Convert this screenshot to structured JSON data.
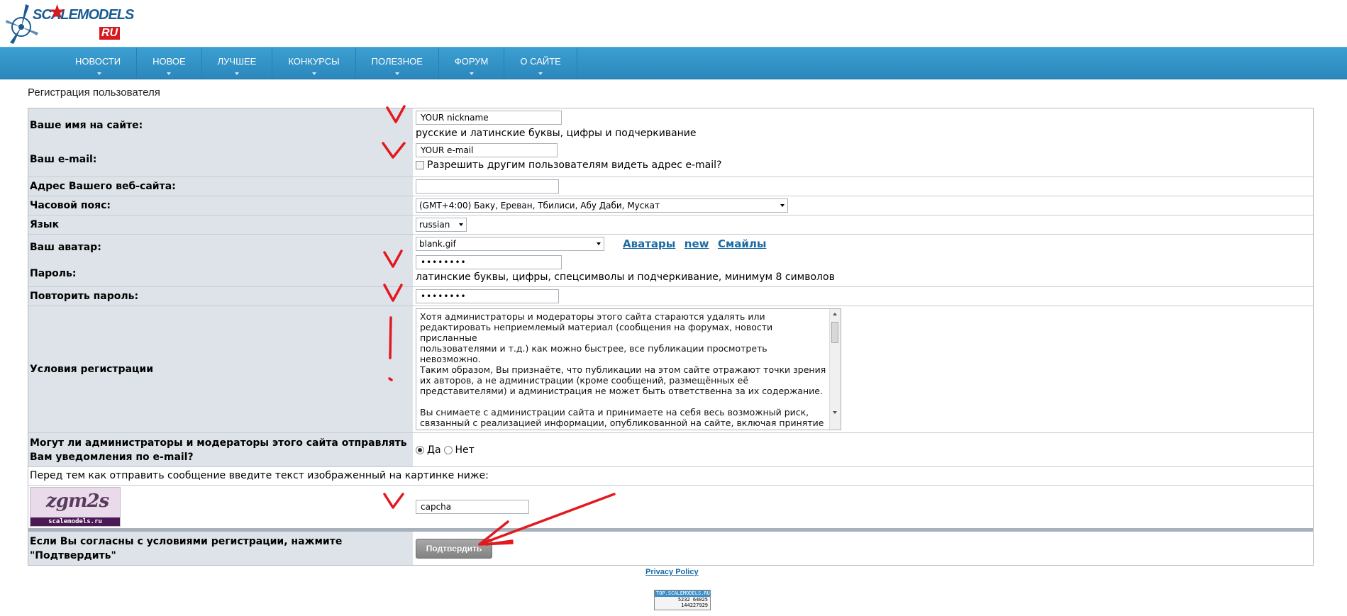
{
  "header": {
    "logo_text": "SCALEMODELS",
    "logo_ru": "RU"
  },
  "nav": {
    "items": [
      {
        "label": "НОВОСТИ"
      },
      {
        "label": "НОВОЕ"
      },
      {
        "label": "ЛУЧШЕЕ"
      },
      {
        "label": "КОНКУРСЫ"
      },
      {
        "label": "ПОЛЕЗНОЕ"
      },
      {
        "label": "ФОРУМ"
      },
      {
        "label": "О САЙТЕ"
      }
    ]
  },
  "page": {
    "title": "Регистрация пользователя"
  },
  "form": {
    "nickname": {
      "label": "Ваше имя на сайте:",
      "value": "YOUR nickname",
      "hint": "русские и латинские буквы, цифры и подчеркивание"
    },
    "email": {
      "label": "Ваш e-mail:",
      "value": "YOUR e-mail",
      "show_email_label": "Разрешить другим пользователям видеть адрес e-mail?"
    },
    "website": {
      "label": "Адрес Вашего веб-сайта:",
      "value": ""
    },
    "timezone": {
      "label": "Часовой пояс:",
      "value": "(GMT+4:00) Баку, Ереван, Тбилиси, Абу Даби, Мускат"
    },
    "language": {
      "label": "Язык",
      "value": "russian"
    },
    "avatar": {
      "label": "Ваш аватар:",
      "value": "blank.gif",
      "links": [
        "Аватары",
        "new",
        "Смайлы"
      ]
    },
    "password": {
      "label": "Пароль:",
      "value": "••••••••",
      "hint": "латинские буквы, цифры, спецсимволы и подчеркивание, минимум 8 символов"
    },
    "password_repeat": {
      "label": "Повторить пароль:",
      "value": "••••••••"
    },
    "terms": {
      "label": "Условия регистрации",
      "text": "Хотя администраторы и модераторы этого сайта стараются удалять или\nредактировать неприемлемый материал (сообщения на форумах, новости присланные\nпользователями и т.д.) как можно быстрее, все публикации просмотреть невозможно.\nТаким образом, Вы признаёте, что публикации на этом сайте отражают точки зрения\nих авторов, а не администрации (кроме сообщений, размещённых её\nпредставителями) и администрация не может быть ответственна за их содержание.\n\nВы снимаете с администрации сайта и принимаете на себя весь возможный риск,\nсвязанный с реализацией информации, опубликованной на сайте, включая принятие\nкоммерческих предложений, совершение сделок, следование техническим советам,\nсоответствие приобретаемых товаров образцам, описанным в обзорах, честностью"
    },
    "notify": {
      "label": "Могут ли администраторы и модераторы этого сайта отправлять Вам уведомления по e-mail?",
      "yes": "Да",
      "no": "Нет",
      "selected": "yes"
    },
    "captcha": {
      "instruction": "Перед тем как отправить сообщение введите текст изображенный на картинке ниже:",
      "image_word": "zgm2s",
      "image_site": "scalemodels.ru",
      "value": "capcha"
    },
    "submit": {
      "label": "Если Вы согласны с условиями регистрации, нажмите \"Подтвердить\"",
      "button": "Подтвердить"
    }
  },
  "footer": {
    "privacy": "Privacy Policy",
    "counter_title": "TOP.SCALEMODELS.RU",
    "counter_line1": "5232  64025",
    "counter_line2": "144227929"
  },
  "colors": {
    "nav": "#2b87bd",
    "label_bg": "#dde3e9",
    "annotation": "#e2191e",
    "link": "#1c6aa4"
  }
}
